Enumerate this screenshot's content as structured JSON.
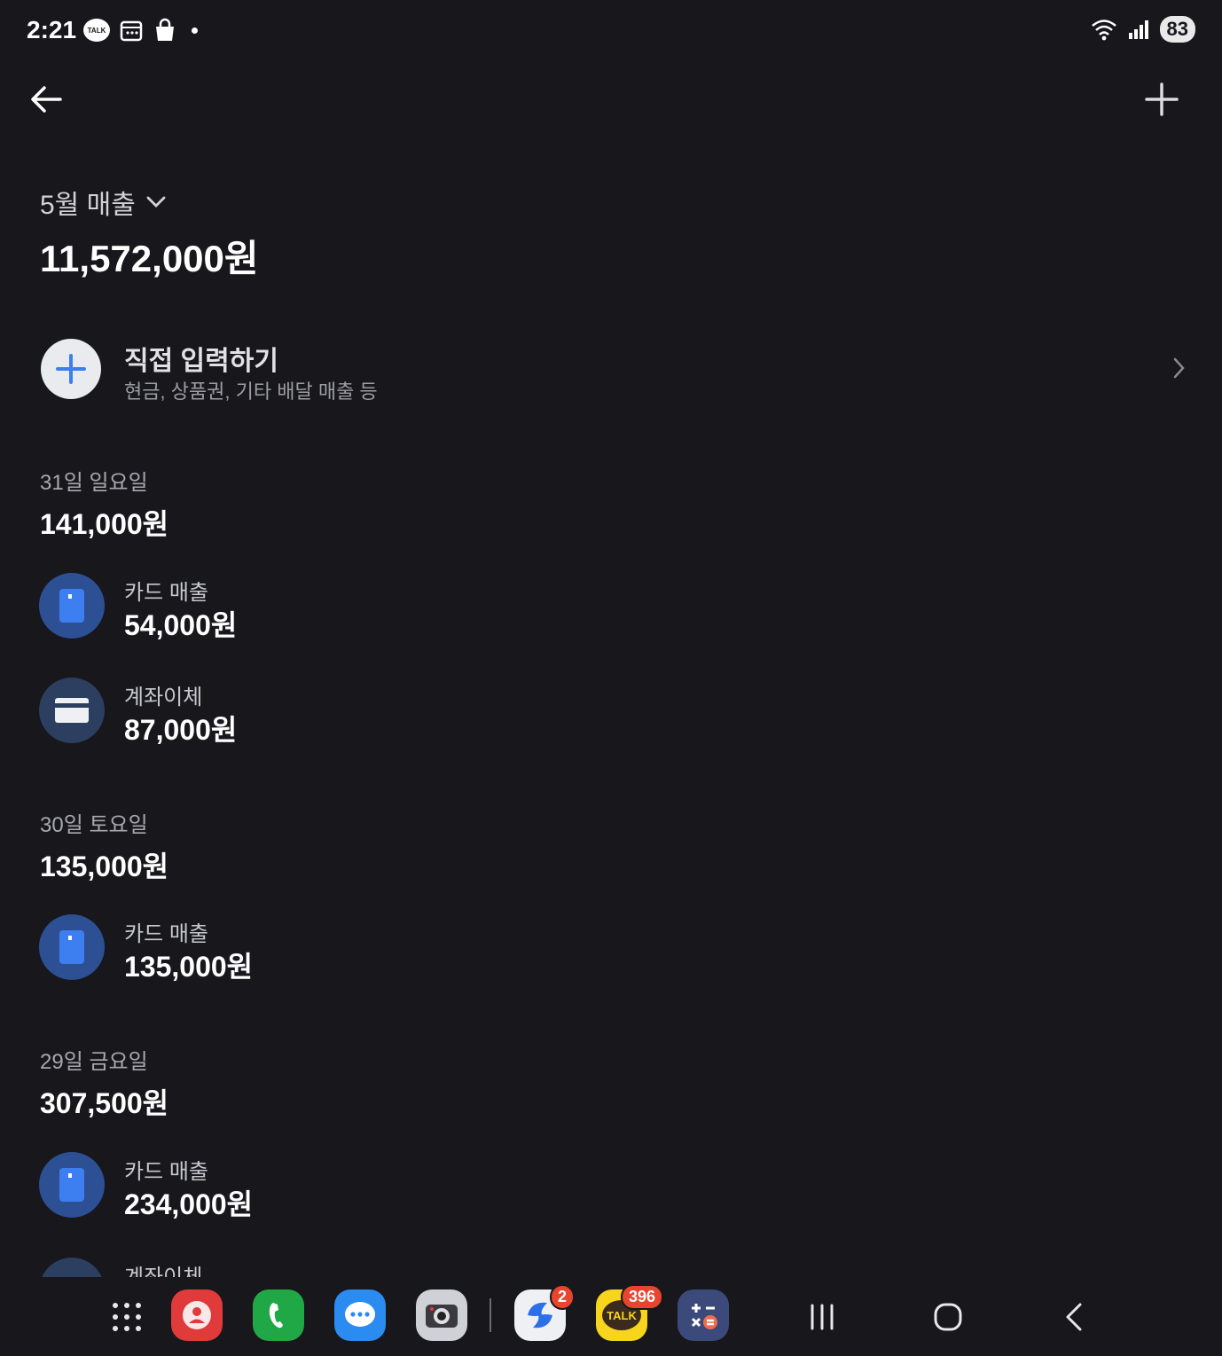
{
  "status_bar": {
    "time": "2:21",
    "talk_icon_text": "TALK",
    "battery": "83"
  },
  "header": {
    "month_label": "5월 매출",
    "total": "11,572,000원"
  },
  "direct_input": {
    "title": "직접 입력하기",
    "subtitle": "현금, 상품권, 기타 배달 매출 등"
  },
  "days": [
    {
      "label": "31일 일요일",
      "total": "141,000원",
      "entries": [
        {
          "type": "card",
          "label": "카드 매출",
          "amount": "54,000원"
        },
        {
          "type": "bank",
          "label": "계좌이체",
          "amount": "87,000원"
        }
      ]
    },
    {
      "label": "30일 토요일",
      "total": "135,000원",
      "entries": [
        {
          "type": "card",
          "label": "카드 매출",
          "amount": "135,000원"
        }
      ]
    },
    {
      "label": "29일 금요일",
      "total": "307,500원",
      "entries": [
        {
          "type": "card",
          "label": "카드 매출",
          "amount": "234,000원"
        },
        {
          "type": "bank",
          "label": "계좌이체",
          "amount": ""
        }
      ]
    }
  ],
  "dock": {
    "messenger_badge": "2",
    "talk_badge": "396",
    "talk_text": "TALK"
  },
  "colors": {
    "background": "#17171c",
    "card_blue": "#2d4f94",
    "accent_blue": "#3d7ff0"
  }
}
